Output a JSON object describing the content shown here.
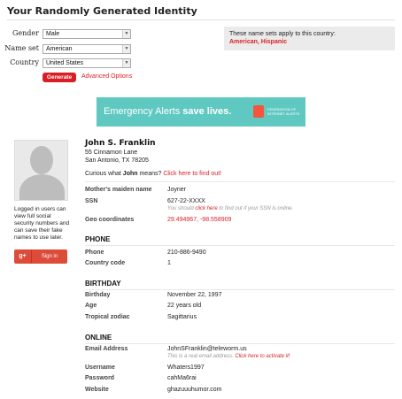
{
  "page": {
    "title": "Your Randomly Generated Identity"
  },
  "form": {
    "gender_label": "Gender",
    "gender_value": "Male",
    "nameset_label": "Name set",
    "nameset_value": "American",
    "country_label": "Country",
    "country_value": "United States",
    "generate_label": "Generate",
    "advanced_label": "Advanced Options"
  },
  "info_box": {
    "text": "These name sets apply to this country:",
    "countries": "American, Hispanic"
  },
  "banner": {
    "text_light": "Emergency Alerts ",
    "text_bold": "save lives.",
    "logo_text": "FEDERATION OF INTERNET ALERTS"
  },
  "sidebar": {
    "login_note": "Logged in users can view full social security numbers and can save their fake names to use later.",
    "gplus_icon": "g+",
    "signin_label": "Sign in"
  },
  "identity": {
    "name": "John S. Franklin",
    "street": "55 Cinnamon Lane",
    "city": "San Antonio, TX 78205",
    "curious_prefix": "Curious what ",
    "curious_name": "John",
    "curious_suffix": " means? ",
    "curious_link": "Click here to find out!",
    "maiden_label": "Mother's maiden name",
    "maiden_value": "Joyner",
    "ssn_label": "SSN",
    "ssn_value": "627-22-XXXX",
    "ssn_note_prefix": "You should ",
    "ssn_note_link": "click here",
    "ssn_note_suffix": " to find out if your SSN is online.",
    "geo_label": "Geo coordinates",
    "geo_value": "29.494967, -98.558909"
  },
  "phone": {
    "section": "PHONE",
    "phone_label": "Phone",
    "phone_value": "210-886-9490",
    "cc_label": "Country code",
    "cc_value": "1"
  },
  "birthday": {
    "section": "BIRTHDAY",
    "bday_label": "Birthday",
    "bday_value": "November 22, 1997",
    "age_label": "Age",
    "age_value": "22 years old",
    "zodiac_label": "Tropical zodiac",
    "zodiac_value": "Sagittarius"
  },
  "online": {
    "section": "ONLINE",
    "email_label": "Email Address",
    "email_value": "JohnSFranklin@teleworm.us",
    "email_note_prefix": "This is a real email address. ",
    "email_note_link": "Click here to activate it!",
    "user_label": "Username",
    "user_value": "Whaters1997",
    "pass_label": "Password",
    "pass_value": "cahMa6rai",
    "web_label": "Website",
    "web_value": "ghazuuuhumor.com"
  },
  "colors": {
    "accent": "#d91f26",
    "banner": "#5fc8c0",
    "gplus": "#dd4b39"
  }
}
